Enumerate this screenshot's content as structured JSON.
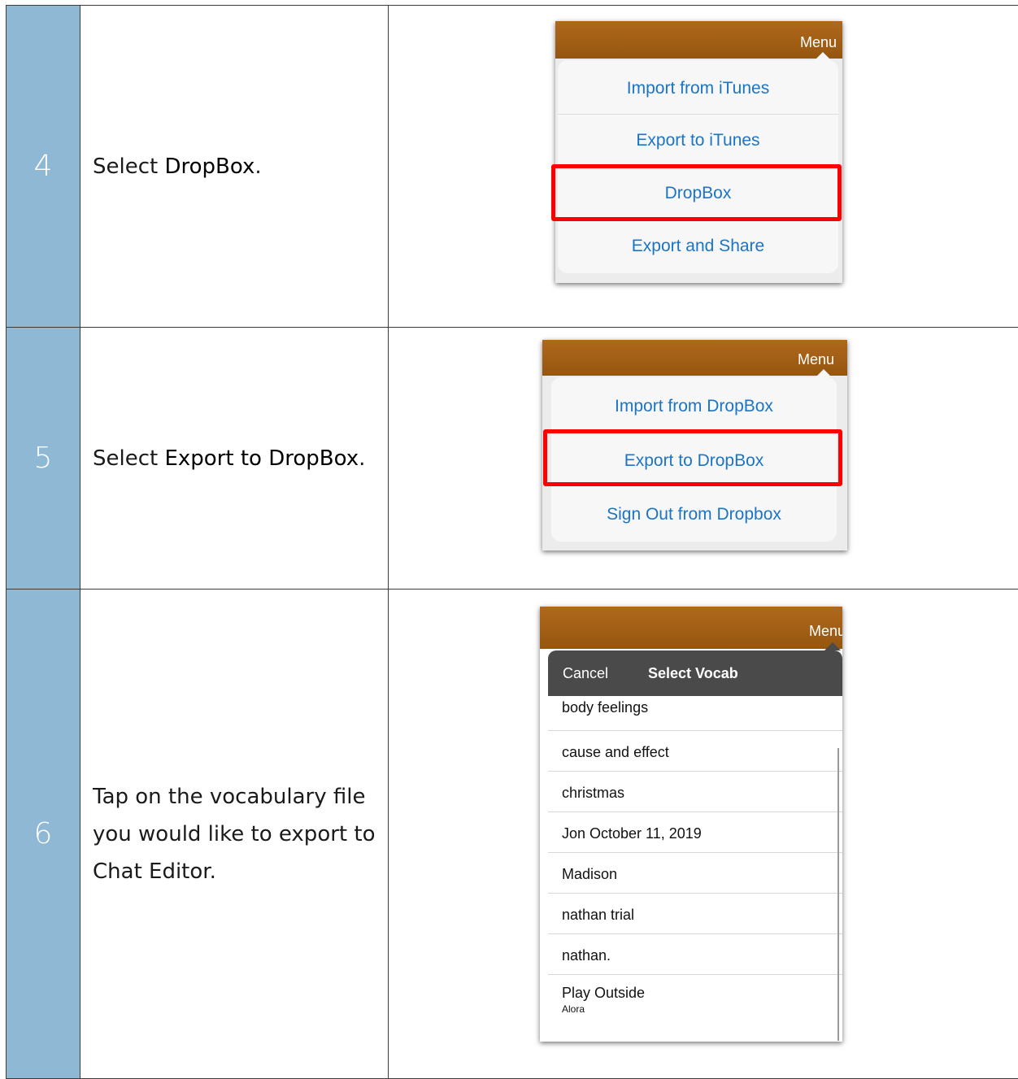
{
  "steps": [
    {
      "number": "4",
      "text_prefix": "Select ",
      "text_bold": "DropBox",
      "text_suffix": ".",
      "screenshot": {
        "menu_label": "Menu",
        "items": [
          "Import from iTunes",
          "Export to iTunes",
          "DropBox",
          "Export and Share"
        ],
        "highlighted": "DropBox"
      }
    },
    {
      "number": "5",
      "text_prefix": "Select ",
      "text_bold": "Export to DropBox",
      "text_suffix": ".",
      "screenshot": {
        "menu_label": "Menu",
        "items": [
          "Import from DropBox",
          "Export to DropBox",
          "Sign Out from Dropbox"
        ],
        "highlighted": "Export to DropBox"
      }
    },
    {
      "number": "6",
      "text_lines": [
        "Tap on the vocabulary file",
        "you would like to export to",
        "Chat Editor."
      ],
      "screenshot": {
        "menu_label": "Menu",
        "cancel_label": "Cancel",
        "title": "Select Vocab",
        "vocab_items": [
          "body feelings",
          "cause and effect",
          "christmas",
          "Jon October 11, 2019",
          "Madison",
          "nathan trial",
          "nathan.",
          "Play Outside"
        ],
        "last_item_subtitle": "Alora"
      }
    }
  ],
  "colors": {
    "number_cell": "#8fb8d4",
    "app_bar": "#a5621a",
    "link_blue": "#1b74c5",
    "highlight_red": "#ff0000",
    "header_dark": "#4a4a4a"
  }
}
